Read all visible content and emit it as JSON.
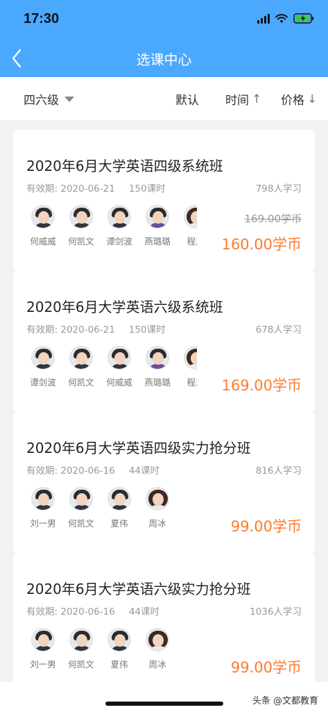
{
  "status": {
    "time": "17:30",
    "icons": [
      "signal-icon",
      "wifi-icon",
      "battery-charging-icon"
    ]
  },
  "nav": {
    "title": "选课中心",
    "back_icon": "chevron-left-icon"
  },
  "filter": {
    "level": "四六级",
    "sort_default": "默认",
    "sort_time": "时间",
    "sort_time_arrow": "↑",
    "sort_price": "价格",
    "sort_price_arrow": "↓"
  },
  "courses": [
    {
      "title": "2020年6月大学英语四级系统班",
      "valid_label": "有效期:",
      "valid_date": "2020-06-21",
      "lessons": "150课时",
      "students": "798人学习",
      "teachers": [
        "何威威",
        "何凯文",
        "谭剑波",
        "燕璐璐",
        "程思"
      ],
      "original_price": "169.00学币",
      "price": "160.00学币"
    },
    {
      "title": "2020年6月大学英语六级系统班",
      "valid_label": "有效期:",
      "valid_date": "2020-06-21",
      "lessons": "150课时",
      "students": "678人学习",
      "teachers": [
        "谭剑波",
        "何凯文",
        "何威威",
        "燕璐璐",
        "程思"
      ],
      "original_price": "",
      "price": "169.00学币"
    },
    {
      "title": "2020年6月大学英语四级实力抢分班",
      "valid_label": "有效期:",
      "valid_date": "2020-06-16",
      "lessons": "44课时",
      "students": "816人学习",
      "teachers": [
        "刘一男",
        "何凯文",
        "夏伟",
        "周冰"
      ],
      "original_price": "",
      "price": "99.00学币"
    },
    {
      "title": "2020年6月大学英语六级实力抢分班",
      "valid_label": "有效期:",
      "valid_date": "2020-06-16",
      "lessons": "44课时",
      "students": "1036人学习",
      "teachers": [
        "刘一男",
        "何凯文",
        "夏伟",
        "周冰"
      ],
      "original_price": "",
      "price": "99.00学币"
    }
  ],
  "watermark": "头条 @文都教育",
  "colors": {
    "brand": "#4aa8ff",
    "price": "#ff7a2b"
  }
}
